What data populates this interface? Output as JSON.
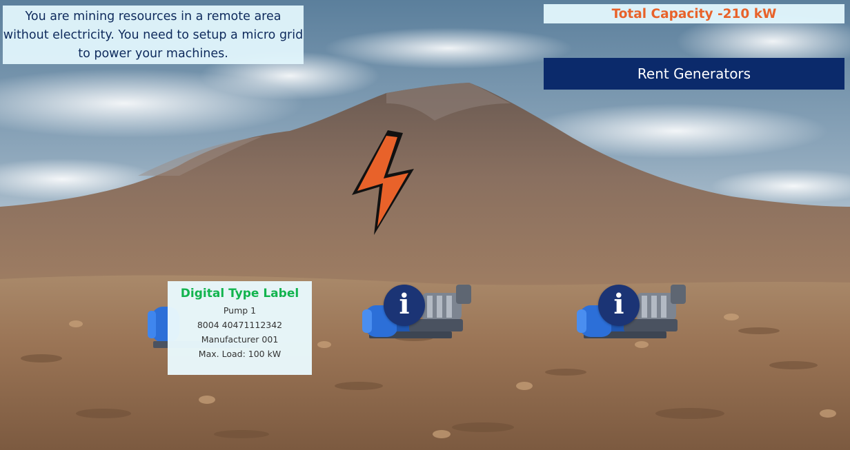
{
  "intro": {
    "text": "You are mining resources in a remote area without electricity. You need to setup a micro grid to power your machines."
  },
  "capacity": {
    "text": "Total Capacity -210 kW"
  },
  "rent_button": {
    "label": "Rent Generators"
  },
  "type_label": {
    "title": "Digital Type Label",
    "name": "Pump 1",
    "serial": "8004 40471112342",
    "manufacturer": "Manufacturer 001",
    "max_load": "Max. Load: 100 kW"
  },
  "pumps": [
    {
      "info_icon": "info-icon"
    },
    {
      "info_icon": "info-icon"
    }
  ],
  "info_glyph": "i",
  "colors": {
    "accent_orange": "#e8622a",
    "navy": "#0b2a6b",
    "info_blue": "#1b3475",
    "label_green": "#12b44e"
  }
}
